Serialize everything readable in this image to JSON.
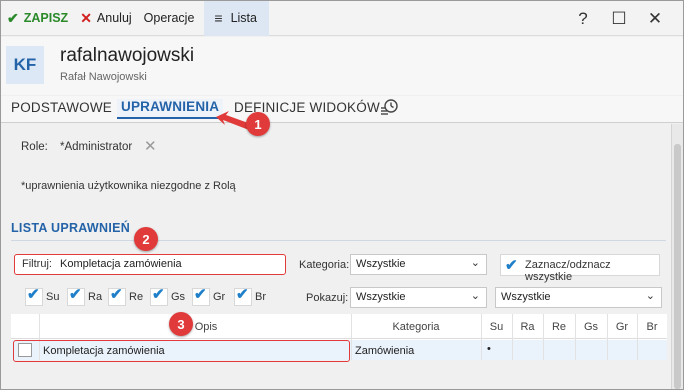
{
  "toolbar": {
    "save_label": "ZAPISZ",
    "cancel_label": "Anuluj",
    "operations_label": "Operacje",
    "list_label": "Lista"
  },
  "window_controls": {
    "help": "?",
    "maximize": "☐",
    "close": "✕"
  },
  "header": {
    "avatar_initials": "KF",
    "title": "rafalnawojowski",
    "subtitle": "Rafał Nawojowski"
  },
  "tabs": [
    {
      "label": "PODSTAWOWE"
    },
    {
      "label": "UPRAWNIENIA",
      "active": true
    },
    {
      "label": "DEFINICJE WIDOKÓW"
    }
  ],
  "role": {
    "label": "Role:",
    "value": "*Administrator"
  },
  "note": "*uprawnienia użytkownika niezgodne z Rolą",
  "section_title": "LISTA UPRAWNIEŃ",
  "filter": {
    "label": "Filtruj:",
    "value": "Kompletacja zamówienia"
  },
  "category": {
    "label": "Kategoria:",
    "value": "Wszystkie"
  },
  "select_all_label": "Zaznacz/odznacz wszystkie",
  "permission_checks": [
    "Su",
    "Ra",
    "Re",
    "Gs",
    "Gr",
    "Br"
  ],
  "show": {
    "label": "Pokazuj:",
    "value1": "Wszystkie",
    "value2": "Wszystkie"
  },
  "table": {
    "columns": [
      "Opis",
      "Kategoria",
      "Su",
      "Ra",
      "Re",
      "Gs",
      "Gr",
      "Br"
    ],
    "rows": [
      {
        "name": "Kompletacja zamówienia",
        "category": "Zamówienia",
        "su": "•"
      }
    ]
  },
  "callouts": [
    "1",
    "2",
    "3"
  ],
  "colors": {
    "accent": "#2463a8",
    "callout": "#e03a3a",
    "save": "#2a8a2a"
  }
}
